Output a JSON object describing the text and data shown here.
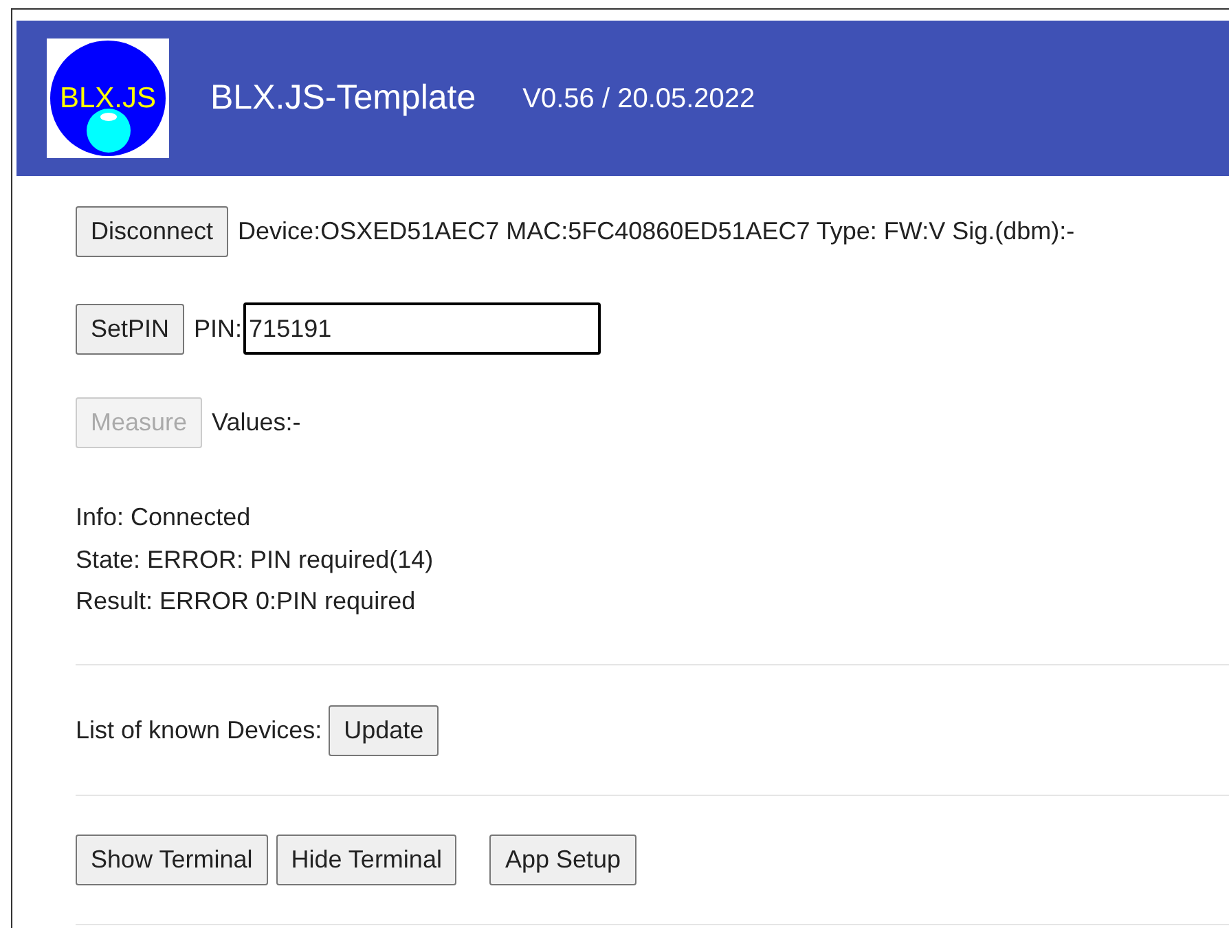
{
  "header": {
    "logo_text": "BLX.JS",
    "title": "BLX.JS-Template",
    "version": "V0.56 / 20.05.2022"
  },
  "connection": {
    "button": {
      "label": "Disconnect",
      "disabled": false
    },
    "device_info": "Device:OSXED51AEC7 MAC:5FC40860ED51AEC7 Type: FW:V Sig.(dbm):-"
  },
  "pin": {
    "button": {
      "label": "SetPIN",
      "disabled": false
    },
    "label": "PIN:",
    "value": "715191"
  },
  "measure": {
    "button": {
      "label": "Measure",
      "disabled": true
    },
    "values": "Values:-"
  },
  "status_lines": [
    "Info: Connected",
    "State: ERROR: PIN required(14)",
    "Result: ERROR 0:PIN required"
  ],
  "devices": {
    "label": "List of known Devices:",
    "button": {
      "label": "Update",
      "disabled": false
    }
  },
  "bottom_buttons": [
    {
      "label": "Show Terminal",
      "disabled": false
    },
    {
      "label": "Hide Terminal",
      "disabled": false
    },
    {
      "label": "App Setup",
      "disabled": false
    }
  ]
}
